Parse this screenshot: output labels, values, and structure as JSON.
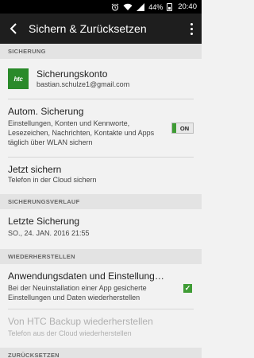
{
  "status_bar": {
    "battery_percent": "44%",
    "time": "20:40"
  },
  "app_bar": {
    "title": "Sichern & Zurücksetzen"
  },
  "sections": {
    "sicherung": "SICHERUNG",
    "sicherungsverlauf": "SICHERUNGSVERLAUF",
    "wiederherstellen": "WIEDERHERSTELLEN",
    "zuruecksetzen": "ZURÜCKSETZEN"
  },
  "account": {
    "logo_text": "htc",
    "title": "Sicherungskonto",
    "email": "bastian.schulze1@gmail.com"
  },
  "autom_sicherung": {
    "title": "Autom. Sicherung",
    "description": "Einstellungen, Konten und Kennworte, Lesezeichen, Nachrichten, Kontakte und Apps täglich über WLAN sichern",
    "toggle_label": "ON",
    "toggle_on": true
  },
  "jetzt_sichern": {
    "title": "Jetzt sichern",
    "description": "Telefon in der Cloud sichern"
  },
  "letzte_sicherung": {
    "title": "Letzte Sicherung",
    "date": "SO., 24. JAN. 2016 21:55"
  },
  "anwendungsdaten": {
    "title": "Anwendungsdaten und Einstellungen...",
    "description": "Bei der Neuinstallation einer App gesicherte Einstellungen und Daten wiederherstellen",
    "checked": true
  },
  "htc_backup": {
    "title": "Von HTC Backup wiederherstellen",
    "description": "Telefon aus der Cloud wiederherstellen",
    "enabled": false
  },
  "colors": {
    "accent_green": "#3f9c35",
    "app_bar": "#1e1e1e",
    "section_header_bg": "#e3e3e3"
  }
}
